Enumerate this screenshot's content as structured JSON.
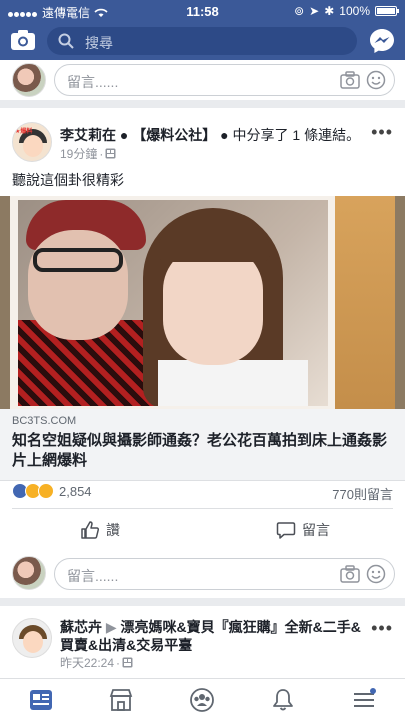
{
  "status": {
    "carrier": "遠傳電信",
    "time": "11:58",
    "battery": "100%"
  },
  "search": {
    "placeholder": "搜尋"
  },
  "comment_box": {
    "placeholder": "留言......"
  },
  "post": {
    "author": "李艾莉在",
    "group": "【爆料公社】",
    "action": "中分享了 1 條連結。",
    "time": "19分鐘",
    "text": "聽說這個卦很精彩",
    "link": {
      "domain": "BC3TS.COM",
      "title": "知名空姐疑似與攝影師通姦？老公花百萬拍到床上通姦影片上網爆料"
    },
    "reactions_count": "2,854",
    "comments_count": "770則留言",
    "like_label": "讚",
    "comment_label": "留言"
  },
  "next_post": {
    "author": "蘇芯卉",
    "target": "漂亮媽咪&寶貝『瘋狂購』全新&二手&買賣&出清&交易平臺",
    "time": "昨天22:24"
  },
  "colors": {
    "brand": "#3b5998",
    "like_blue": "#4267b2",
    "haha_yellow": "#f7b125"
  },
  "icons": [
    "camera-icon",
    "search-icon",
    "messenger-icon",
    "emoji-icon",
    "globe-icon",
    "like-icon",
    "comment-icon",
    "news-feed-icon",
    "marketplace-icon",
    "groups-icon",
    "notifications-icon",
    "menu-icon"
  ]
}
